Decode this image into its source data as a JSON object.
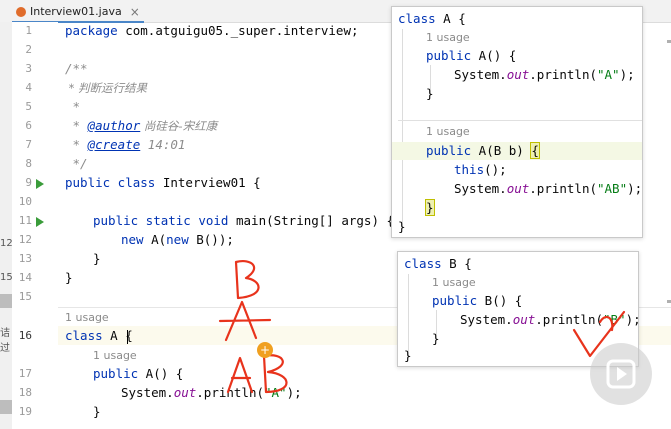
{
  "tab": {
    "title": "Interview01.java",
    "close": "×"
  },
  "left_strip": {
    "m1": "12",
    "m2": "15",
    "m3": "诘过"
  },
  "editor": {
    "lines": [
      {
        "n": "1"
      },
      {
        "n": "2"
      },
      {
        "n": "3"
      },
      {
        "n": "4"
      },
      {
        "n": "5"
      },
      {
        "n": "6"
      },
      {
        "n": "7"
      },
      {
        "n": "8"
      },
      {
        "n": "9"
      },
      {
        "n": "10"
      },
      {
        "n": "11"
      },
      {
        "n": "12"
      },
      {
        "n": "13"
      },
      {
        "n": "14"
      },
      {
        "n": "15"
      },
      {
        "n": "16"
      },
      {
        "n": "17"
      },
      {
        "n": "18"
      },
      {
        "n": "19"
      }
    ],
    "code": {
      "package_kw": "package",
      "package_name": " com.atguigu05._super.interview;",
      "doc_open": "/**",
      "doc_desc": " * 判断运行结果",
      "doc_star": " *",
      "doc_author_pre": " * ",
      "doc_author_tag": "@author",
      "doc_author_val": " 尚硅谷-宋红康",
      "doc_create_pre": " * ",
      "doc_create_tag": "@create",
      "doc_create_val": " 14:01",
      "doc_close": " */",
      "class_kw": "public class",
      "class_name": " Interview01 {",
      "main_kw": "public static void",
      "main_sig": " main(String[] args) {",
      "new_kw": "new",
      "new_a": " A(",
      "new_kw2": "new",
      "new_b": " B());",
      "close_brace": "}",
      "usage_label": "1 usage",
      "classA_kw": "class",
      "classA_name": " A {",
      "ctorA_kw": "public",
      "ctorA_name": " A() {",
      "sysout_pre": "System.",
      "sysout_out": "out",
      "sysout_post": ".println(",
      "str_A": "\"A\"",
      "sysout_end": ");"
    }
  },
  "popup_a": {
    "class_kw": "class",
    "class_name": " A {",
    "usage1": "1 usage",
    "ctor_kw": "public",
    "ctor_name": " A() {",
    "print_pre": "System.",
    "print_out": "out",
    "print_mid": ".println(",
    "print_str": "\"A\"",
    "print_end": ");",
    "close": "}",
    "usage2": "1 usage",
    "ctor2_kw": "public",
    "ctor2_name": " A(B b) ",
    "ctor2_brace": "{",
    "this_kw": "this",
    "this_end": "();",
    "print2_str": "\"AB\"",
    "close2": "}",
    "close3": "}"
  },
  "popup_b": {
    "class_kw": "class",
    "class_name": " B {",
    "usage": "1 usage",
    "ctor_kw": "public",
    "ctor_name": " B() {",
    "print_pre": "System.",
    "print_out": "out",
    "print_mid": ".println(",
    "print_str": "\"B\"",
    "print_end": ");",
    "close": "}",
    "close2": "}"
  },
  "annotations": {
    "cursor_symbol": "+"
  },
  "colors": {
    "keyword": "#0033b3",
    "string": "#067d17",
    "comment": "#8c8c8c",
    "field": "#871094",
    "ink": "#e8331c",
    "run": "#3a9c3a"
  }
}
